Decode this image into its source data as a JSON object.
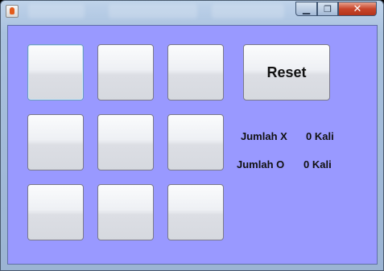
{
  "window": {
    "colors": {
      "content_background": "#9999ff",
      "close_button": "#c8452b",
      "frame": "#a9c1de"
    },
    "icons": {
      "app": "java-icon",
      "minimize": "minimize-icon",
      "maximize": "maximize-icon",
      "close": "close-icon"
    },
    "controls": {
      "minimize_glyph": "▁",
      "maximize_glyph": "❐",
      "close_glyph": "✕"
    }
  },
  "board": {
    "cells": [
      "",
      "",
      "",
      "",
      "",
      "",
      "",
      "",
      ""
    ]
  },
  "reset_button": {
    "label": "Reset"
  },
  "score": {
    "x_label": "Jumlah X",
    "x_value": "0 Kali",
    "o_label": "Jumlah O",
    "o_value": "0 Kali"
  }
}
